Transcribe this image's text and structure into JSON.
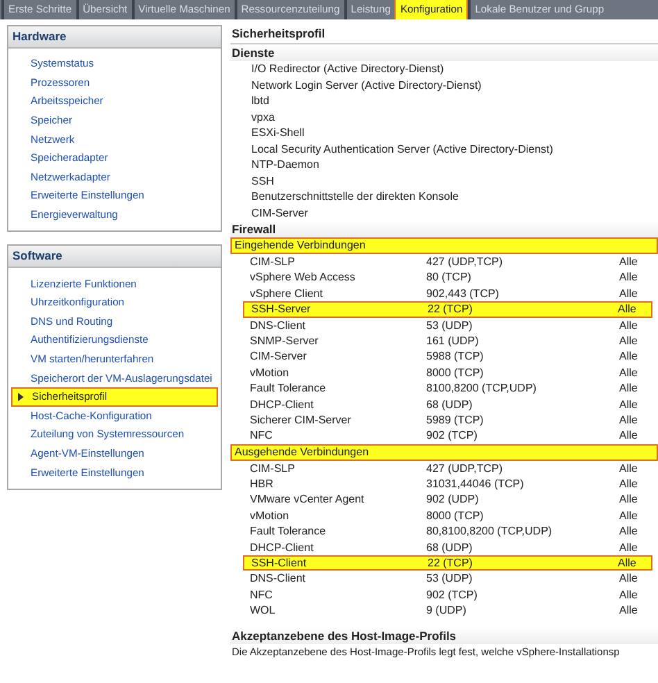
{
  "tabs": [
    {
      "label": "Erste Schritte",
      "selected": false
    },
    {
      "label": "Übersicht",
      "selected": false
    },
    {
      "label": "Virtuelle Maschinen",
      "selected": false
    },
    {
      "label": "Ressourcenzuteilung",
      "selected": false
    },
    {
      "label": "Leistung",
      "selected": false
    },
    {
      "label": "Konfiguration",
      "selected": true
    },
    {
      "label": "Lokale Benutzer und Grupp",
      "selected": false
    }
  ],
  "sidebar": {
    "sections": [
      {
        "title": "Hardware",
        "items": [
          {
            "label": "Systemstatus",
            "selected": false
          },
          {
            "label": "Prozessoren",
            "selected": false
          },
          {
            "label": "Arbeitsspeicher",
            "selected": false
          },
          {
            "label": "Speicher",
            "selected": false
          },
          {
            "label": "Netzwerk",
            "selected": false
          },
          {
            "label": "Speicheradapter",
            "selected": false
          },
          {
            "label": "Netzwerkadapter",
            "selected": false
          },
          {
            "label": "Erweiterte Einstellungen",
            "selected": false
          },
          {
            "label": "Energieverwaltung",
            "selected": false
          }
        ]
      },
      {
        "title": "Software",
        "items": [
          {
            "label": "Lizenzierte Funktionen",
            "selected": false
          },
          {
            "label": "Uhrzeitkonfiguration",
            "selected": false
          },
          {
            "label": "DNS und Routing",
            "selected": false
          },
          {
            "label": "Authentifizierungsdienste",
            "selected": false
          },
          {
            "label": "VM starten/herunterfahren",
            "selected": false
          },
          {
            "label": "Speicherort der VM-Auslagerungsdatei",
            "selected": false
          },
          {
            "label": "Sicherheitsprofil",
            "selected": true
          },
          {
            "label": "Host-Cache-Konfiguration",
            "selected": false
          },
          {
            "label": "Zuteilung von Systemressourcen",
            "selected": false
          },
          {
            "label": "Agent-VM-Einstellungen",
            "selected": false
          },
          {
            "label": "Erweiterte Einstellungen",
            "selected": false
          }
        ]
      }
    ]
  },
  "content": {
    "title": "Sicherheitsprofil",
    "services": {
      "heading": "Dienste",
      "items": [
        "I/O Redirector (Active Directory-Dienst)",
        "Network Login Server (Active Directory-Dienst)",
        "lbtd",
        "vpxa",
        "ESXi-Shell",
        "Local Security Authentication Server (Active Directory-Dienst)",
        "NTP-Daemon",
        "SSH",
        "Benutzerschnittstelle der direkten Konsole",
        "CIM-Server"
      ]
    },
    "firewall": {
      "heading": "Firewall",
      "groups": [
        {
          "label": "Eingehende Verbindungen",
          "highlighted": true,
          "rows": [
            {
              "name": "CIM-SLP",
              "port": "427 (UDP,TCP)",
              "scope": "Alle",
              "highlighted": false
            },
            {
              "name": "vSphere Web Access",
              "port": "80 (TCP)",
              "scope": "Alle",
              "highlighted": false
            },
            {
              "name": "vSphere Client",
              "port": "902,443 (TCP)",
              "scope": "Alle",
              "highlighted": false
            },
            {
              "name": "SSH-Server",
              "port": "22 (TCP)",
              "scope": "Alle",
              "highlighted": true
            },
            {
              "name": "DNS-Client",
              "port": "53 (UDP)",
              "scope": "Alle",
              "highlighted": false
            },
            {
              "name": "SNMP-Server",
              "port": "161 (UDP)",
              "scope": "Alle",
              "highlighted": false
            },
            {
              "name": "CIM-Server",
              "port": "5988 (TCP)",
              "scope": "Alle",
              "highlighted": false
            },
            {
              "name": "vMotion",
              "port": "8000 (TCP)",
              "scope": "Alle",
              "highlighted": false
            },
            {
              "name": "Fault Tolerance",
              "port": "8100,8200 (TCP,UDP)",
              "scope": "Alle",
              "highlighted": false
            },
            {
              "name": "DHCP-Client",
              "port": "68 (UDP)",
              "scope": "Alle",
              "highlighted": false
            },
            {
              "name": "Sicherer CIM-Server",
              "port": "5989 (TCP)",
              "scope": "Alle",
              "highlighted": false
            },
            {
              "name": "NFC",
              "port": "902 (TCP)",
              "scope": "Alle",
              "highlighted": false
            }
          ]
        },
        {
          "label": "Ausgehende Verbindungen",
          "highlighted": true,
          "rows": [
            {
              "name": "CIM-SLP",
              "port": "427 (UDP,TCP)",
              "scope": "Alle",
              "highlighted": false
            },
            {
              "name": "HBR",
              "port": "31031,44046 (TCP)",
              "scope": "Alle",
              "highlighted": false
            },
            {
              "name": "VMware vCenter Agent",
              "port": "902 (UDP)",
              "scope": "Alle",
              "highlighted": false
            },
            {
              "name": "vMotion",
              "port": "8000 (TCP)",
              "scope": "Alle",
              "highlighted": false
            },
            {
              "name": "Fault Tolerance",
              "port": "80,8100,8200 (TCP,UDP)",
              "scope": "Alle",
              "highlighted": false
            },
            {
              "name": "DHCP-Client",
              "port": "68 (UDP)",
              "scope": "Alle",
              "highlighted": false
            },
            {
              "name": "SSH-Client",
              "port": "22 (TCP)",
              "scope": "Alle",
              "highlighted": true
            },
            {
              "name": "DNS-Client",
              "port": "53 (UDP)",
              "scope": "Alle",
              "highlighted": false
            },
            {
              "name": "NFC",
              "port": "902 (TCP)",
              "scope": "Alle",
              "highlighted": false
            },
            {
              "name": "WOL",
              "port": "9 (UDP)",
              "scope": "Alle",
              "highlighted": false
            }
          ]
        }
      ]
    },
    "acceptance": {
      "heading": "Akzeptanzebene des Host-Image-Profils",
      "text": "Die Akzeptanzebene des Host-Image-Profils legt fest, welche vSphere-Installationsp"
    }
  }
}
